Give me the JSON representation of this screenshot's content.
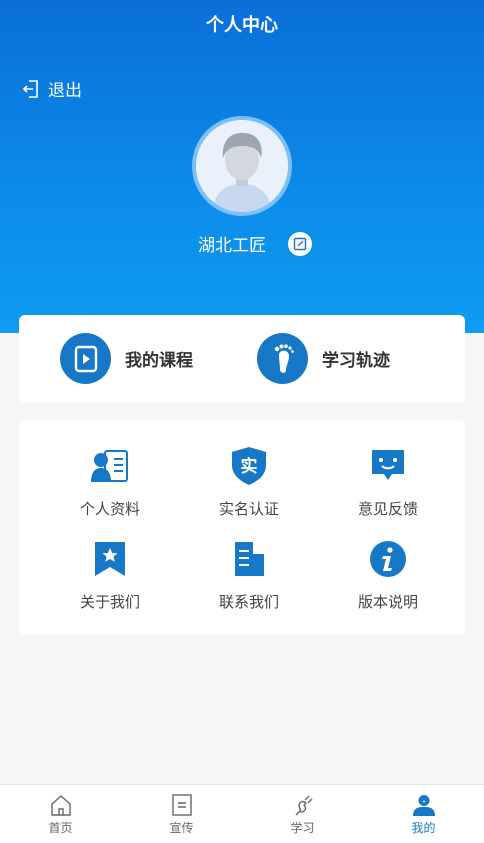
{
  "header": {
    "title": "个人中心",
    "logout_label": "退出",
    "username": "湖北工匠"
  },
  "quick_links": [
    {
      "label": "我的课程",
      "icon": "play-book-icon"
    },
    {
      "label": "学习轨迹",
      "icon": "footprint-icon"
    }
  ],
  "menu": [
    {
      "label": "个人资料",
      "icon": "profile-card-icon"
    },
    {
      "label": "实名认证",
      "icon": "shield-verify-icon"
    },
    {
      "label": "意见反馈",
      "icon": "feedback-chat-icon"
    },
    {
      "label": "关于我们",
      "icon": "bookmark-star-icon"
    },
    {
      "label": "联系我们",
      "icon": "building-icon"
    },
    {
      "label": "版本说明",
      "icon": "info-icon"
    }
  ],
  "shield_char": "实",
  "tabs": [
    {
      "label": "首页",
      "icon": "home-icon",
      "active": false
    },
    {
      "label": "宣传",
      "icon": "document-icon",
      "active": false
    },
    {
      "label": "学习",
      "icon": "plug-icon",
      "active": false
    },
    {
      "label": "我的",
      "icon": "user-icon",
      "active": true
    }
  ],
  "colors": {
    "accent": "#1778c8",
    "header_top": "#0a6fd8",
    "header_bottom": "#0f9cf2"
  }
}
